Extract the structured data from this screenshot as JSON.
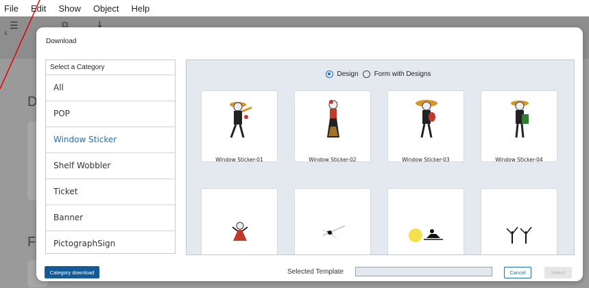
{
  "menu": [
    "File",
    "Edit",
    "Show",
    "Object",
    "Help"
  ],
  "background": {
    "toolbar_partial_label": "S",
    "letter_1": "D",
    "letter_2": "F"
  },
  "dialog": {
    "title": "Download",
    "category_header": "Select a Category",
    "categories": [
      "All",
      "POP",
      "Window Sticker",
      "Shelf Wobbler",
      "Ticket",
      "Banner",
      "PictographSign"
    ],
    "selected_category": "Window Sticker",
    "radio_options": [
      "Design",
      "Form with Designs"
    ],
    "radio_selected": "Design",
    "designs": [
      {
        "label": "Window Sticker-01",
        "icon": "mariachi-trumpet-icon"
      },
      {
        "label": "Window Sticker-02",
        "icon": "catrina-dress-icon"
      },
      {
        "label": "Window Sticker-03",
        "icon": "mariachi-guitar-icon"
      },
      {
        "label": "Window Sticker-04",
        "icon": "mariachi-accordion-icon"
      },
      {
        "label": "",
        "icon": "catrina-dancer-icon"
      },
      {
        "label": "",
        "icon": "spider-web-icon"
      },
      {
        "label": "",
        "icon": "moon-witch-icon"
      },
      {
        "label": "",
        "icon": "bare-trees-icon"
      }
    ],
    "category_download_label": "Category download",
    "selected_template_label": "Selected Template",
    "selected_template_value": "",
    "cancel_label": "Cancel",
    "select_label": "Select",
    "colors": {
      "accent": "#1d6fb8",
      "primary_button": "#145a96",
      "panel_bg": "#e4e8ef"
    }
  }
}
